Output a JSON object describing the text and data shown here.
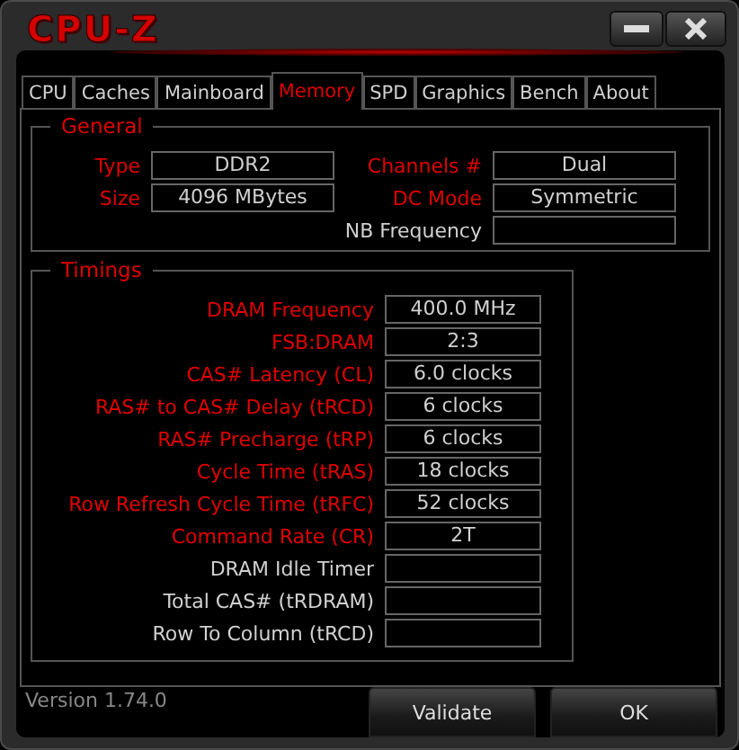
{
  "window": {
    "title": "CPU-Z"
  },
  "tabs": [
    {
      "label": "CPU",
      "selected": false
    },
    {
      "label": "Caches",
      "selected": false
    },
    {
      "label": "Mainboard",
      "selected": false
    },
    {
      "label": "Memory",
      "selected": true
    },
    {
      "label": "SPD",
      "selected": false
    },
    {
      "label": "Graphics",
      "selected": false
    },
    {
      "label": "Bench",
      "selected": false
    },
    {
      "label": "About",
      "selected": false
    }
  ],
  "general": {
    "title": "General",
    "left": [
      {
        "label": "Type",
        "value": "DDR2",
        "active": true
      },
      {
        "label": "Size",
        "value": "4096 MBytes",
        "active": true
      }
    ],
    "right": [
      {
        "label": "Channels #",
        "value": "Dual",
        "active": true
      },
      {
        "label": "DC Mode",
        "value": "Symmetric",
        "active": true
      },
      {
        "label": "NB Frequency",
        "active": false
      }
    ]
  },
  "timings": {
    "title": "Timings",
    "rows": [
      {
        "label": "DRAM Frequency",
        "value": "400.0 MHz",
        "active": true
      },
      {
        "label": "FSB:DRAM",
        "value": "2:3",
        "active": true
      },
      {
        "label": "CAS# Latency (CL)",
        "value": "6.0 clocks",
        "active": true
      },
      {
        "label": "RAS# to CAS# Delay (tRCD)",
        "value": "6 clocks",
        "active": true
      },
      {
        "label": "RAS# Precharge (tRP)",
        "value": "6 clocks",
        "active": true
      },
      {
        "label": "Cycle Time (tRAS)",
        "value": "18 clocks",
        "active": true
      },
      {
        "label": "Row Refresh Cycle Time (tRFC)",
        "value": "52 clocks",
        "active": true
      },
      {
        "label": "Command Rate (CR)",
        "value": "2T",
        "active": true
      },
      {
        "label": "DRAM Idle Timer",
        "active": false
      },
      {
        "label": "Total CAS# (tRDRAM)",
        "active": false
      },
      {
        "label": "Row To Column (tRCD)",
        "active": false
      }
    ]
  },
  "footer": {
    "version": "Version 1.74.0",
    "buttons": [
      "Validate",
      "OK"
    ]
  }
}
